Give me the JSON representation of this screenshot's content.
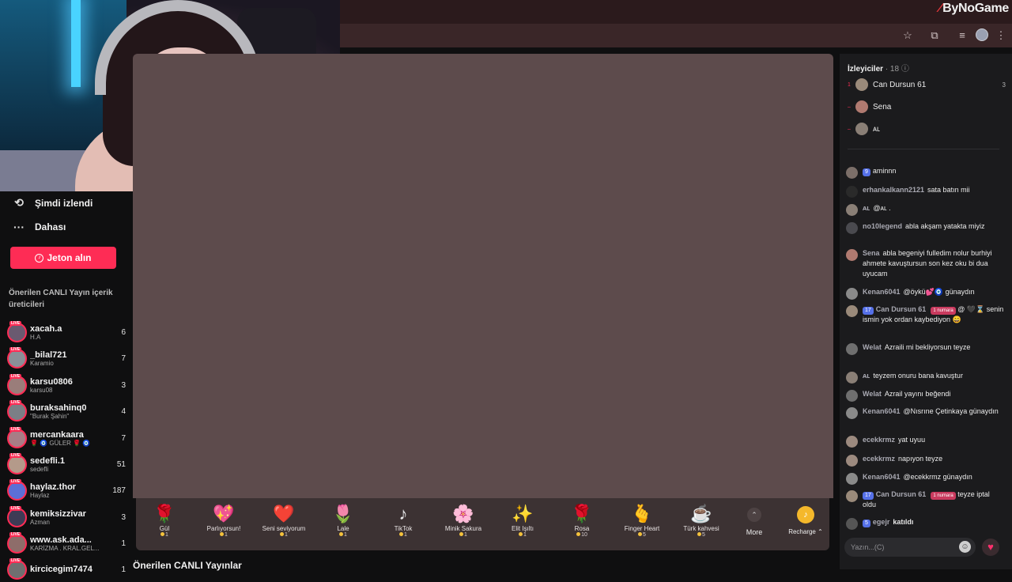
{
  "brand": {
    "text": "ByNoGame"
  },
  "sidebar": {
    "history_label": "Şimdi izlendi",
    "more_label": "Dahası",
    "coin_button": "Jeton alın",
    "recommended_title": "Önerilen CANLI Yayın içerik üreticileri",
    "creators": [
      {
        "name": "xacah.a",
        "sub": "H.A",
        "count": "6",
        "color": "#6a5a70"
      },
      {
        "name": "_bilal721",
        "sub": "Karamio",
        "count": "7",
        "color": "#8a8f97"
      },
      {
        "name": "karsu0806",
        "sub": "karsu08",
        "count": "3",
        "color": "#9a7d7a"
      },
      {
        "name": "buraksahinq0",
        "sub": "\"Burak Şahin\"",
        "count": "4",
        "color": "#7b7f86"
      },
      {
        "name": "mercankaara",
        "sub": "🌹 🧿 GÜLER 🌹 🧿",
        "count": "7",
        "color": "#a87d86"
      },
      {
        "name": "sedefli.1",
        "sub": "sedefli",
        "count": "51",
        "color": "#b49a8a"
      },
      {
        "name": "haylaz.thor",
        "sub": "Haylaz",
        "count": "187",
        "color": "#5c6fd6"
      },
      {
        "name": "kemiksizzivar",
        "sub": "Azman",
        "count": "3",
        "color": "#3e3b55"
      },
      {
        "name": "www.ask.ada...",
        "sub": "KARİZMA . KRAL.GEL...",
        "count": "1",
        "color": "#8e6d6a"
      },
      {
        "name": "kircicegim7474",
        "sub": "",
        "count": "1",
        "color": "#6f6f70"
      }
    ]
  },
  "stream": {
    "recommended_live_title": "Önerilen CANLI Yayınlar",
    "gifts": [
      {
        "name": "Gül",
        "price": "1",
        "icon": "🌹"
      },
      {
        "name": "Parlıyorsun!",
        "price": "1",
        "icon": "💖"
      },
      {
        "name": "Seni seviyorum",
        "price": "1",
        "icon": "❤️"
      },
      {
        "name": "Lale",
        "price": "1",
        "icon": "🌷"
      },
      {
        "name": "TikTok",
        "price": "1",
        "icon": "♪"
      },
      {
        "name": "Minik Sakura",
        "price": "1",
        "icon": "🌸"
      },
      {
        "name": "Elit Işıltı",
        "price": "1",
        "icon": "✨"
      },
      {
        "name": "Rosa",
        "price": "10",
        "icon": "🌹"
      },
      {
        "name": "Finger Heart",
        "price": "5",
        "icon": "🫰"
      },
      {
        "name": "Türk kahvesi",
        "price": "5",
        "icon": "☕"
      }
    ],
    "more_label": "More",
    "recharge_label": "Recharge ⌃"
  },
  "chat": {
    "viewers_title": "İzleyiciler",
    "viewers_count": "· 18 ⓘ",
    "top_viewers": [
      {
        "rank": "1",
        "name": "Can Dursun 61",
        "count": "3",
        "color": "#9a8a7a"
      },
      {
        "rank": "–",
        "name": "Sena",
        "count": "",
        "color": "#b07a70"
      },
      {
        "rank": "–",
        "name": "ᴀʟ",
        "count": "",
        "color": "#8a7f76"
      }
    ],
    "messages": [
      {
        "user": "",
        "level": "9",
        "text": "aminnn",
        "color": "#7c6f69"
      },
      {
        "user": "erhankalkann2121",
        "level": "",
        "text": "sata batın mii",
        "color": "#2a2a2a"
      },
      {
        "user": "ᴀʟ",
        "level": "",
        "text": "@ᴀʟ .",
        "color": "#8a7f76"
      },
      {
        "user": "no10legend",
        "level": "",
        "text": "abla akşam yatakta miyiz",
        "color": "#4a4a4f"
      },
      {
        "user": "Sena",
        "level": "",
        "text": "abla begeniyi fulledim nolur burhiyi ahmete kavuştursun son kez oku bi dua uyucam",
        "color": "#b07a70"
      },
      {
        "user": "Kenan6041",
        "level": "",
        "text": "@öykü💕🧿 günaydın",
        "color": "#8a8a8a"
      },
      {
        "user": "Can Dursun 61",
        "level": "17",
        "badge": "1 numara",
        "text": "@ 🖤⌛ senin ismin yok ordan kaybediyon 😄",
        "color": "#9a8a7a"
      },
      {
        "user": "Welat",
        "level": "",
        "text": "Azraili mi bekliyorsun teyze",
        "color": "#6f6f6f"
      },
      {
        "user": "ᴀʟ",
        "level": "",
        "text": "teyzem onuru bana kavuştur",
        "color": "#8a7f76"
      },
      {
        "user": "Welat",
        "level": "",
        "text": "Azrail yayını beğendi",
        "color": "#6f6f6f"
      },
      {
        "user": "Kenan6041",
        "level": "",
        "text": "@Nısrıne Çetinkaya günaydın",
        "color": "#8a8a8a"
      },
      {
        "user": "ecekkrmz",
        "level": "",
        "text": "yat uyuu",
        "color": "#9c8a7f"
      },
      {
        "user": "ecekkrmz",
        "level": "",
        "text": "napıyon teyze",
        "color": "#9c8a7f"
      },
      {
        "user": "Kenan6041",
        "level": "",
        "text": "@ecekkrmz günaydın",
        "color": "#8a8a8a"
      },
      {
        "user": "Can Dursun 61",
        "level": "17",
        "badge": "1 numara",
        "text": "teyze iptal oldu",
        "color": "#9a8a7a"
      },
      {
        "user": "egejr",
        "level": "5",
        "text": "katıldı",
        "joined": true,
        "color": "#555"
      }
    ],
    "input_placeholder": "Yazın...(C)"
  }
}
